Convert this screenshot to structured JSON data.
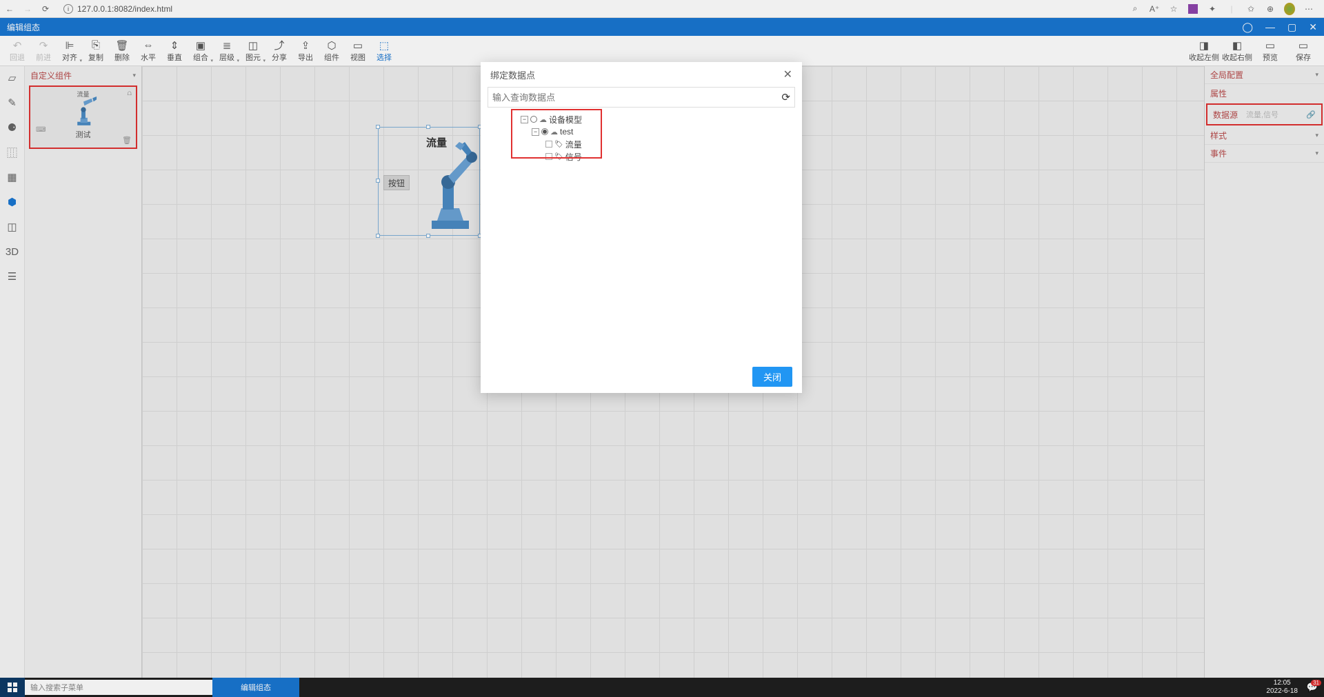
{
  "browser": {
    "url": "127.0.0.1:8082/index.html"
  },
  "titlebar": {
    "title": "编辑组态"
  },
  "toolbar": {
    "undo": "回退",
    "redo": "前进",
    "align": "对齐",
    "copy": "复制",
    "delete": "删除",
    "horiz": "水平",
    "vert": "垂直",
    "group": "组合",
    "layer": "层级",
    "element": "图元",
    "share": "分享",
    "export": "导出",
    "component": "组件",
    "view": "视图",
    "select": "选择",
    "collapse_left": "收起左侧",
    "collapse_right": "收起右侧",
    "preview": "预览",
    "save": "保存"
  },
  "left_panel": {
    "header": "自定义组件",
    "card": {
      "top_label": "流量",
      "label": "测试"
    }
  },
  "canvas": {
    "flow_label": "流量",
    "button_label": "按钮"
  },
  "right_panel": {
    "global": "全局配置",
    "prop": "属性",
    "datasource_label": "数据源",
    "datasource_value": "流量,信号",
    "style": "样式",
    "event": "事件"
  },
  "dialog": {
    "title": "绑定数据点",
    "search_placeholder": "输入查询数据点",
    "tree": {
      "root": "设备模型",
      "node": "test",
      "leaf1": "流量",
      "leaf2": "信号"
    },
    "close_btn": "关闭"
  },
  "taskbar": {
    "search_placeholder": "输入搜索子菜单",
    "app": "编辑组态",
    "time": "12:05",
    "date": "2022-6-18",
    "notif_count": "31"
  }
}
